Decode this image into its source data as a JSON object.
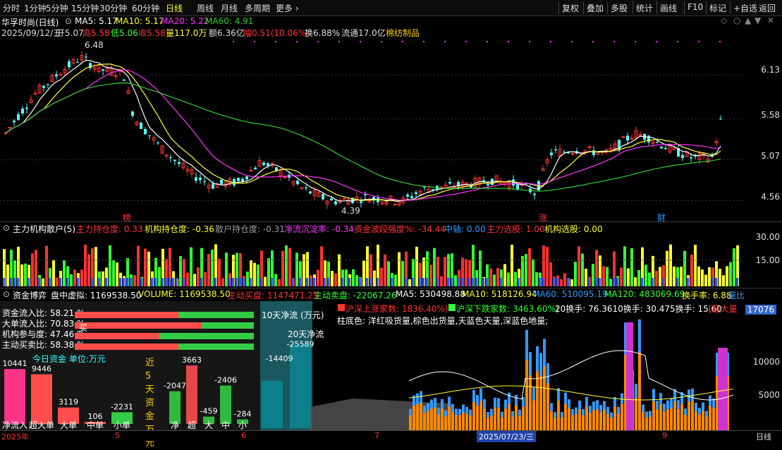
{
  "toolbar": {
    "left_tabs": [
      "分时",
      "1分钟",
      "5分钟",
      "15分钟",
      "30分钟",
      "60分钟",
      "日线",
      "周线",
      "月线",
      "多周期",
      "更多"
    ],
    "active_tab": "日线",
    "right_buttons": [
      "复权",
      "叠加",
      "多股",
      "统计",
      "画线",
      "F10",
      "标记",
      "+自选",
      "返回"
    ]
  },
  "stock": {
    "title": "华孚时尚(日线)",
    "ma": {
      "ma5": "MA5: 5.17",
      "ma10": "MA10: 5.17",
      "ma20": "MA20: 5.22",
      "ma60": "MA60: 4.91"
    },
    "date": "2025/09/12/五",
    "open": "开5.07",
    "high": "高5.58",
    "low": "低5.06",
    "close": "收5.58",
    "volume": "量117.0万",
    "amount": "额6.36亿",
    "change": "幅0.51(10.06%)",
    "turnover": "换6.88%",
    "float_cap": "流通17.0亿",
    "sector": "棉纺制品"
  },
  "price_axis": [
    "6.13",
    "5.58",
    "5.07",
    "4.56"
  ],
  "price_annotations": {
    "high_mark": "6.48",
    "low_mark": "4.39"
  },
  "event_markers": [
    "榜",
    "涨",
    "财"
  ],
  "main_chart": {
    "series": [
      "K线",
      "MA5",
      "MA10",
      "MA20",
      "MA60"
    ],
    "ma_colors": {
      "ma5": "#ffffff",
      "ma10": "#ffff33",
      "ma20": "#ff33ff",
      "ma60": "#33cc33"
    },
    "up_color": "#ff3333",
    "down_color": "#54ffff"
  },
  "indicator": {
    "title": "主力机构散户(5)",
    "items": [
      {
        "label": "主力持仓度: 0.33",
        "color": "#ff3333"
      },
      {
        "label": "机构持仓度: -0.36",
        "color": "#ffff33"
      },
      {
        "label": "散户持仓度: -0.31",
        "color": "#999999"
      },
      {
        "label": "净流沉淀率: -0.34",
        "color": "#ff33ff"
      },
      {
        "label": "资金波段强度%: -34.44",
        "color": "#ff3333"
      },
      {
        "label": "中轴: 0.00",
        "color": "#3399ff"
      },
      {
        "label": "主力选股: 1.00",
        "color": "#ff3333"
      },
      {
        "label": "机构选股: 0.00",
        "color": "#ffff33"
      }
    ],
    "axis": [
      "30.00",
      "15.00"
    ]
  },
  "fund": {
    "title": "资金博弈",
    "items": [
      {
        "label": "盘中虚拟: 1169538.50",
        "color": "#ffffff"
      },
      {
        "label": "VOLUME: 1169538.50",
        "color": "#ffff33"
      },
      {
        "label": "主动买盘: 1147471.25",
        "color": "#ff3333"
      },
      {
        "label": "主动卖盘: -22067.26",
        "color": "#33ff33"
      },
      {
        "label": "MA5: 530498.88",
        "color": "#ffffff"
      },
      {
        "label": "MA10: 518126.94",
        "color": "#ffff33"
      },
      {
        "label": "MA60: 510095.19",
        "color": "#3399ff"
      },
      {
        "label": "MA120: 483069.69",
        "color": "#33ff33"
      },
      {
        "label": "换手率: 6.88",
        "color": "#ffff33"
      },
      {
        "label": "量比",
        "color": "#3399ff"
      }
    ],
    "ratios": [
      {
        "label": "资金流入比: 58.21 %",
        "fill": 0.58
      },
      {
        "label": "大单流入比: 70.83 %",
        "fill": 0.71,
        "suffix": "买"
      },
      {
        "label": "机构参与度: 47.46 %",
        "fill": 0.47
      },
      {
        "label": "主动买卖比: 58.38 %",
        "fill": 0.58
      }
    ],
    "today_title": "今日资金 单位:万元",
    "today_values": [
      "10441",
      "9446",
      "3119",
      "106",
      "-2231"
    ],
    "today_labels": [
      "净流入",
      "超大单",
      "大单",
      "中单",
      "小单"
    ],
    "recent5_title": "近5天资金万元",
    "recent5_values": [
      "-2047",
      "3663",
      "-459",
      "-2406",
      "-284"
    ],
    "recent5_labels": [
      "净",
      "超",
      "大",
      "中",
      "小"
    ],
    "net10_title": "10天净流 (万元)",
    "net20_title": "20天净流",
    "net10_value": "-14409",
    "net20_value": "-25589",
    "market_up": "沪深上涨家数: 1836.40%)",
    "market_down": "沪深下跌家数: 3463.60%)",
    "turnover20": "20换手: 76.3610换手: 30.475换手: 15.60",
    "super_big": "[超大量",
    "bar_legend": "柱底色: 洋红吸货量,棕色出货量,天蓝色天量,深蓝色地量;",
    "vol_axis": [
      "17076",
      "10000",
      "5000"
    ],
    "bottom_dates": [
      "2025年",
      "5",
      "6",
      "7",
      "2025/07/23/三",
      "9"
    ],
    "corner_label": "日线"
  }
}
